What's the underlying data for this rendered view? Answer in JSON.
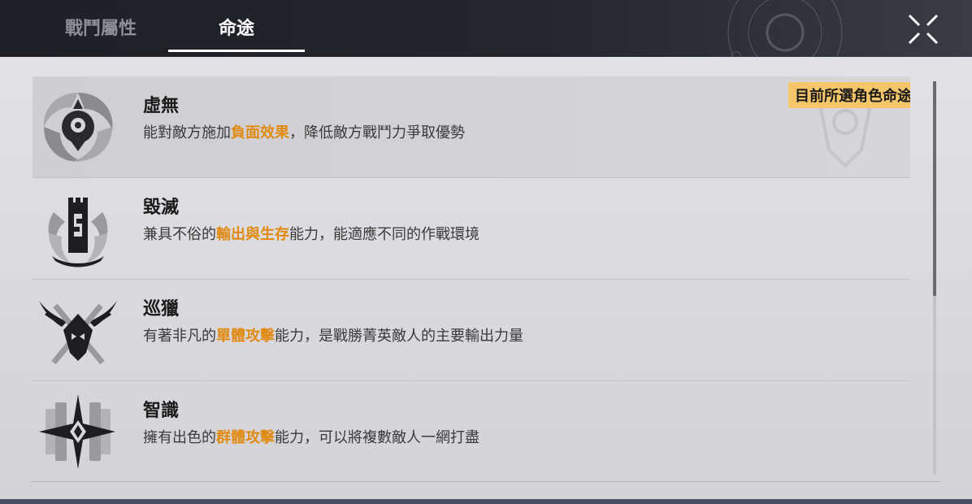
{
  "tabs": [
    {
      "label": "戰鬥屬性",
      "active": false
    },
    {
      "label": "命途",
      "active": true
    }
  ],
  "close_icon": "close-x-icon",
  "paths": [
    {
      "name": "虛無",
      "desc_before": "能對敵方施加",
      "desc_highlight": "負面效果",
      "desc_after": "，降低敵方戰鬥力爭取優勢",
      "icon": "nihility-emblem-icon",
      "selected": true,
      "badge": "目前所選角色命途"
    },
    {
      "name": "毀滅",
      "desc_before": "兼具不俗的",
      "desc_highlight": "輸出與生存",
      "desc_after": "能力，能適應不同的作戰環境",
      "icon": "destruction-emblem-icon",
      "selected": false
    },
    {
      "name": "巡獵",
      "desc_before": "有著非凡的",
      "desc_highlight": "單體攻擊",
      "desc_after": "能力，是戰勝菁英敵人的主要輸出力量",
      "icon": "hunt-emblem-icon",
      "selected": false
    },
    {
      "name": "智識",
      "desc_before": "擁有出色的",
      "desc_highlight": "群體攻擊",
      "desc_after": "能力，可以將複數敵人一網打盡",
      "icon": "erudition-emblem-icon",
      "selected": false
    }
  ],
  "colors": {
    "highlight": "#e08a12",
    "badge": "#f5c66a",
    "topbar": "#1e2026",
    "panel": "#dddde1"
  }
}
